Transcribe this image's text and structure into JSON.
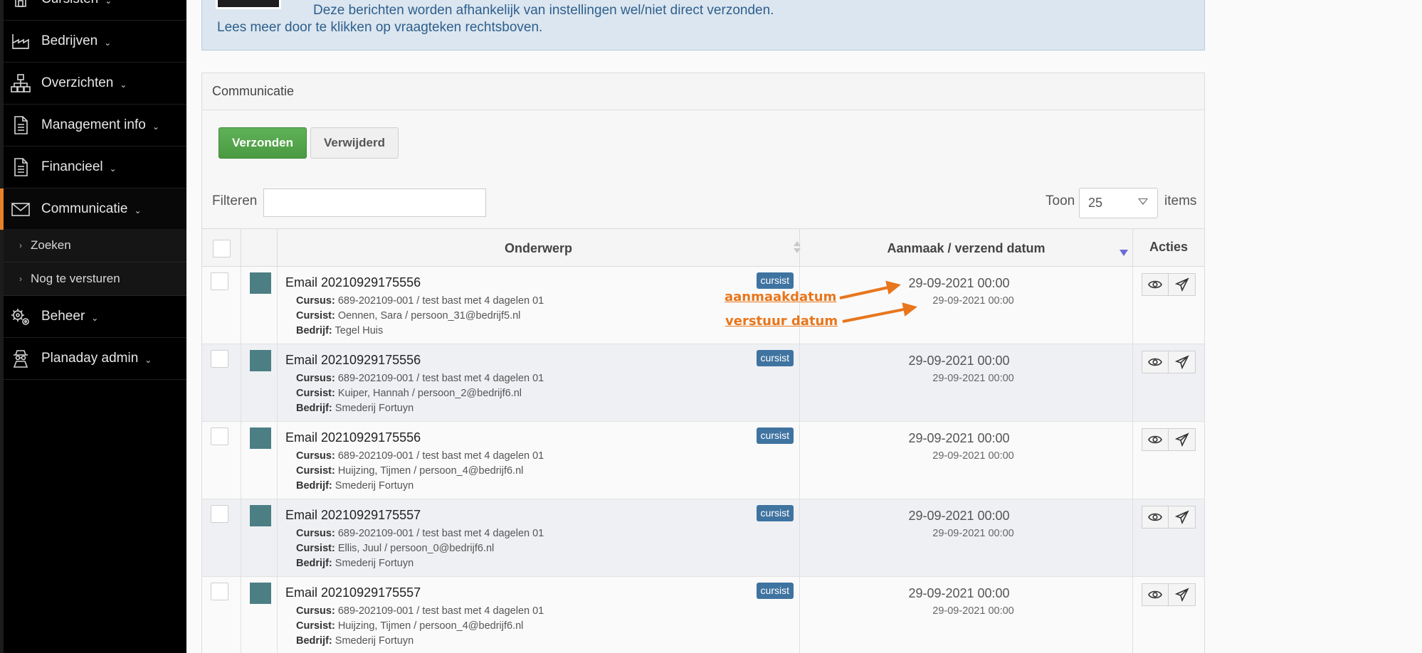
{
  "sidebar": {
    "items": [
      {
        "label": "Cursisten",
        "icon": "house-icon"
      },
      {
        "label": "Bedrijven",
        "icon": "factory-icon"
      },
      {
        "label": "Overzichten",
        "icon": "sitemap-icon"
      },
      {
        "label": "Management info",
        "icon": "document-icon"
      },
      {
        "label": "Financieel",
        "icon": "document-icon"
      },
      {
        "label": "Communicatie",
        "icon": "envelope-icon"
      },
      {
        "label": "Beheer",
        "icon": "gears-icon"
      },
      {
        "label": "Planaday admin",
        "icon": "user-secret-icon"
      }
    ],
    "subitems": [
      {
        "label": "Zoeken"
      },
      {
        "label": "Nog te versturen"
      }
    ]
  },
  "info": {
    "line1": "Deze berichten worden afhankelijk van instellingen wel/niet direct verzonden.",
    "line2": "Lees meer door te klikken op vraagteken rechtsboven."
  },
  "panel": {
    "title": "Communicatie",
    "btn_sent": "Verzonden",
    "btn_deleted": "Verwijderd",
    "filter_label": "Filteren",
    "filter_value": "",
    "show_label": "Toon",
    "show_value": "25",
    "items_label": "items"
  },
  "table": {
    "headers": {
      "subject": "Onderwerp",
      "date": "Aanmaak / verzend datum",
      "actions": "Acties"
    },
    "field_labels": {
      "cursus": "Cursus:",
      "cursist": "Cursist:",
      "bedrijf": "Bedrijf:"
    },
    "rows": [
      {
        "title": "Email 20210929175556",
        "badge": "cursist",
        "cursus": "689-202109-001 / test bast met 4 dagelen 01",
        "cursist": "Oennen, Sara / persoon_31@bedrijf5.nl",
        "bedrijf": "Tegel Huis",
        "created": "29-09-2021 00:00",
        "sent": "29-09-2021 00:00"
      },
      {
        "title": "Email 20210929175556",
        "badge": "cursist",
        "cursus": "689-202109-001 / test bast met 4 dagelen 01",
        "cursist": "Kuiper, Hannah / persoon_2@bedrijf6.nl",
        "bedrijf": "Smederij Fortuyn",
        "created": "29-09-2021 00:00",
        "sent": "29-09-2021 00:00"
      },
      {
        "title": "Email 20210929175556",
        "badge": "cursist",
        "cursus": "689-202109-001 / test bast met 4 dagelen 01",
        "cursist": "Huijzing, Tijmen / persoon_4@bedrijf6.nl",
        "bedrijf": "Smederij Fortuyn",
        "created": "29-09-2021 00:00",
        "sent": "29-09-2021 00:00"
      },
      {
        "title": "Email 20210929175557",
        "badge": "cursist",
        "cursus": "689-202109-001 / test bast met 4 dagelen 01",
        "cursist": "Ellis, Juul / persoon_0@bedrijf6.nl",
        "bedrijf": "Smederij Fortuyn",
        "created": "29-09-2021 00:00",
        "sent": "29-09-2021 00:00"
      },
      {
        "title": "Email 20210929175557",
        "badge": "cursist",
        "cursus": "689-202109-001 / test bast met 4 dagelen 01",
        "cursist": "Huijzing, Tijmen / persoon_4@bedrijf6.nl",
        "bedrijf": "Smederij Fortuyn",
        "created": "29-09-2021 00:00",
        "sent": "29-09-2021 00:00"
      }
    ]
  },
  "annotations": {
    "created_label": "aanmaakdatum",
    "sent_label": "verstuur datum",
    "color": "#e8761c"
  },
  "colors": {
    "accent": "#e8822a",
    "primary_button": "#4a9a41",
    "badge": "#3f73a0",
    "status_square": "#4b7f84",
    "info_text": "#2f5f8c"
  }
}
